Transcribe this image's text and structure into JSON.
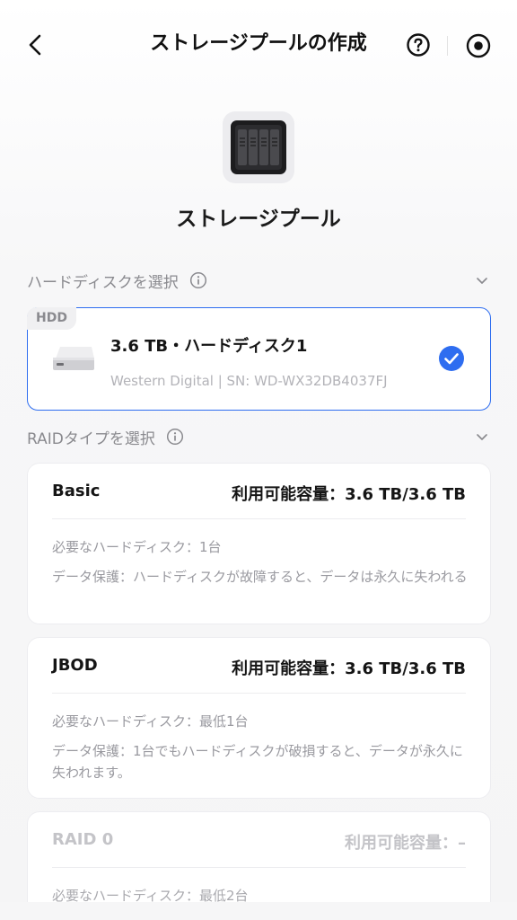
{
  "header": {
    "title": "ストレージプールの作成",
    "back_icon": "chevron-left-icon",
    "help_icon": "help-circle-icon",
    "target_icon": "target-icon"
  },
  "pool": {
    "icon": "nas-enclosure-icon",
    "label": "ストレージプール"
  },
  "disk_section": {
    "label": "ハードディスクを選択",
    "info_icon": "info-icon",
    "chevron_icon": "chevron-down-icon"
  },
  "disk": {
    "tag": "HDD",
    "title": "3.6 TB・ハードディスク1",
    "subtitle": "Western Digital  |  SN: WD-WX32DB4037FJ",
    "selected": true
  },
  "raid_section": {
    "label": "RAIDタイプを選択",
    "info_icon": "info-icon",
    "chevron_icon": "chevron-down-icon"
  },
  "raid_options": [
    {
      "name": "Basic",
      "capacity": "利用可能容量：3.6 TB/3.6 TB",
      "requirement": "必要なハードディスク：1台",
      "protection": "データ保護：ハードディスクが故障すると、データは永久に失われる",
      "enabled": true
    },
    {
      "name": "JBOD",
      "capacity": "利用可能容量：3.6 TB/3.6 TB",
      "requirement": "必要なハードディスク：最低1台",
      "protection": "データ保護：1台でもハードディスクが破損すると、データが永久に失われます。",
      "enabled": true
    },
    {
      "name": "RAID 0",
      "capacity": "利用可能容量：–",
      "requirement": "必要なハードディスク：最低2台",
      "protection": "",
      "enabled": false
    }
  ],
  "colors": {
    "accent": "#2e6df0",
    "muted_text": "#8a8a8f",
    "disabled_text": "#c4c4c8"
  }
}
